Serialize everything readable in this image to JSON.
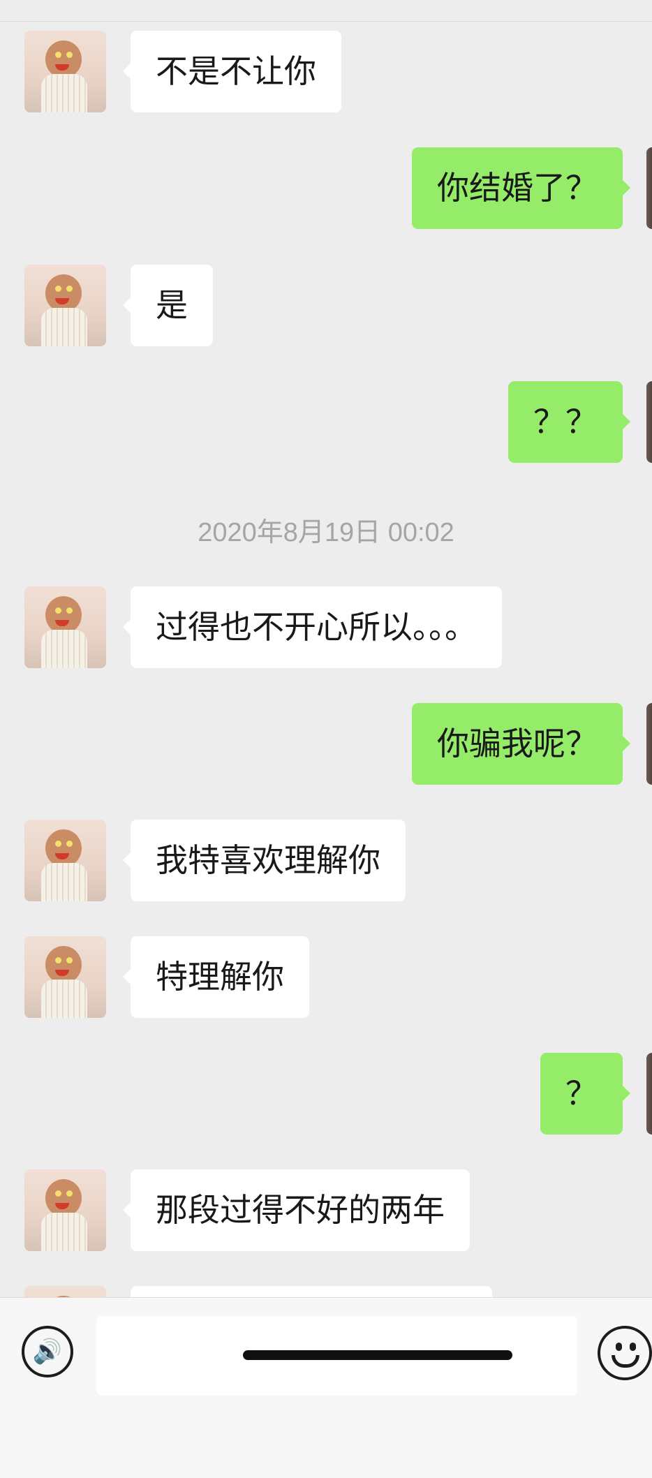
{
  "messages": [
    {
      "side": "in",
      "text": "不是不让你"
    },
    {
      "side": "out",
      "text": "你结婚了？"
    },
    {
      "side": "in",
      "text": "是"
    },
    {
      "side": "out",
      "text": "？？"
    },
    {
      "side": "in",
      "text": "过得也不开心所以。。。"
    },
    {
      "side": "out",
      "text": "你骗我呢？"
    },
    {
      "side": "in",
      "text": "我特喜欢理解你"
    },
    {
      "side": "in",
      "text": "特理解你"
    },
    {
      "side": "out",
      "text": "？"
    },
    {
      "side": "in",
      "text": "那段过得不好的两年"
    },
    {
      "side": "in",
      "text": ""
    }
  ],
  "timestamp": "2020年8月19日 00:02",
  "input": {
    "value": "",
    "placeholder": ""
  },
  "icons": {
    "voice": "voice-icon",
    "emoji": "emoji-icon"
  },
  "colors": {
    "background": "#ededed",
    "incoming_bubble": "#ffffff",
    "outgoing_bubble": "#95ec69",
    "timestamp_text": "#a5a5a5"
  }
}
